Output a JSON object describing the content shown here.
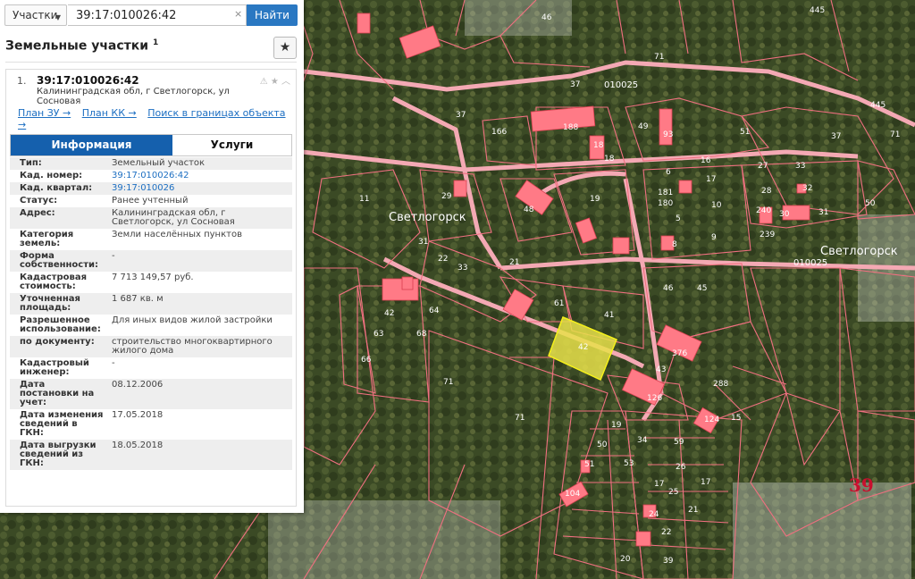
{
  "search": {
    "layer_label": "Участки",
    "query": "39:17:010026:42",
    "clear_glyph": "×",
    "button_label": "Найти"
  },
  "panel": {
    "title": "Земельные участки",
    "title_sup": "1",
    "star_icon": "star-icon"
  },
  "result": {
    "number": "1.",
    "cad_number": "39:17:010026:42",
    "address": "Калининградская обл, г Светлогорск, ул Сосновая",
    "links": [
      "План ЗУ →",
      "План КК →",
      "Поиск в границах объекта →"
    ]
  },
  "tabs": [
    "Информация",
    "Услуги"
  ],
  "info": [
    {
      "key": "Тип:",
      "value": "Земельный участок"
    },
    {
      "key": "Кад. номер:",
      "value": "39:17:010026:42",
      "link": true
    },
    {
      "key": "Кад. квартал:",
      "value": "39:17:010026",
      "link": true
    },
    {
      "key": "Статус:",
      "value": "Ранее учтенный"
    },
    {
      "key": "Адрес:",
      "value": "Калининградская обл, г Светлогорск, ул Сосновая"
    },
    {
      "key": "Категория земель:",
      "value": "Земли населённых пунктов"
    },
    {
      "key": "Форма собственности:",
      "value": "-"
    },
    {
      "key": "Кадастровая стоимость:",
      "value": "7 713 149,57 руб."
    },
    {
      "key": "Уточненная площадь:",
      "value": "1 687 кв. м"
    },
    {
      "key": "Разрешенное использование:",
      "value": "Для иных видов жилой застройки"
    },
    {
      "key": "по документу:",
      "value": "строительство многоквартирного жилого дома"
    },
    {
      "key": "Кадастровый инженер:",
      "value": "-"
    },
    {
      "key": "Дата постановки на учет:",
      "value": "08.12.2006"
    },
    {
      "key": "Дата изменения сведений в ГКН:",
      "value": "17.05.2018"
    },
    {
      "key": "Дата выгрузки сведений из ГКН:",
      "value": "18.05.2018"
    }
  ],
  "map": {
    "town_labels": [
      "Светлогорск",
      "Светлогорск"
    ],
    "quarter_labels": [
      "010025",
      "010025"
    ],
    "district_label": "39",
    "selected_parcel": "42",
    "colors": {
      "boundary": "#f07080",
      "road": "#f4a9b4",
      "building": "#ff7a86",
      "selected": "#e8e04a"
    },
    "parcel_labels": [
      "46",
      "445",
      "71",
      "37",
      "37",
      "445",
      "166",
      "188",
      "18",
      "18",
      "49",
      "93",
      "51",
      "37",
      "71",
      "27",
      "33",
      "6",
      "16",
      "17",
      "28",
      "32",
      "11",
      "19",
      "50",
      "48",
      "181",
      "180",
      "10",
      "240",
      "30",
      "239",
      "31",
      "5",
      "8",
      "9",
      "29",
      "31",
      "22",
      "33",
      "21",
      "46",
      "45",
      "61",
      "41",
      "42",
      "64",
      "63",
      "66",
      "68",
      "71",
      "71",
      "376",
      "43",
      "288",
      "126",
      "19",
      "59",
      "50",
      "34",
      "51",
      "53",
      "104",
      "24",
      "17",
      "26",
      "25",
      "17",
      "21",
      "22",
      "20",
      "39",
      "15",
      "124"
    ]
  }
}
